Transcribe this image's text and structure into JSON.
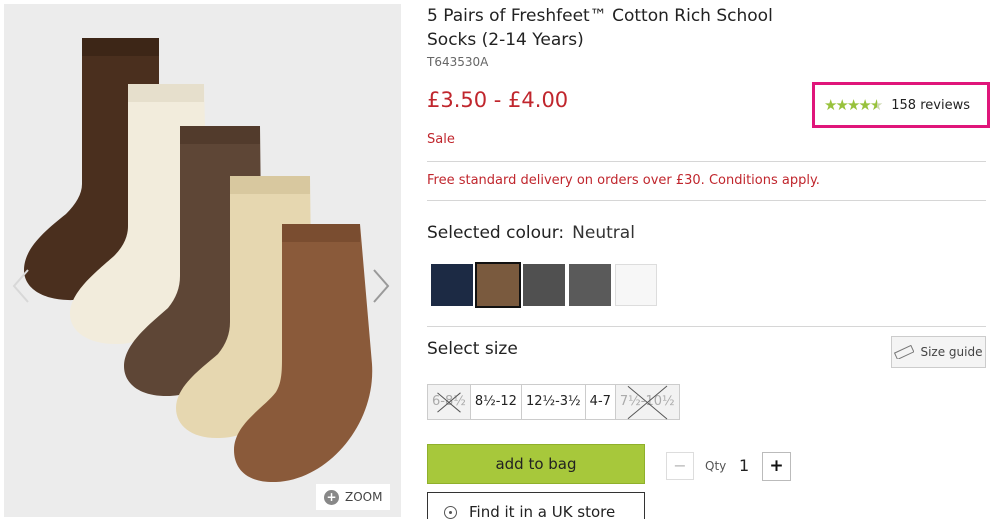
{
  "product": {
    "title": "5 Pairs of Freshfeet™ Cotton Rich School Socks (2-14 Years)",
    "code": "T643530A",
    "price": "£3.50 - £4.00",
    "sale_label": "Sale",
    "delivery_note": "Free standard delivery on orders over £30. Conditions apply."
  },
  "reviews": {
    "rating": 4.5,
    "max_rating": 5,
    "count_label": "158 reviews",
    "star_color": "#98c23c",
    "highlight_color": "#e0157a"
  },
  "gallery": {
    "zoom_label": "ZOOM",
    "zoom_icon": "plus-circle-icon",
    "prev_icon": "chevron-left-icon",
    "next_icon": "chevron-right-icon",
    "sock_colors": [
      "#4a2f1e",
      "#f2ecdc",
      "#5e4636",
      "#e6d7b0",
      "#8a5a3a"
    ]
  },
  "colour": {
    "label": "Selected colour:",
    "selected": "Neutral",
    "swatches": [
      {
        "color": "#1c2a44",
        "selected": false
      },
      {
        "color": "#7a5a3e",
        "selected": true
      },
      {
        "color": "#505050",
        "selected": false
      },
      {
        "color": "#5a5a5a",
        "selected": false
      },
      {
        "color": "#f7f7f7",
        "selected": false
      }
    ]
  },
  "size": {
    "label": "Select size",
    "guide_label": "Size guide",
    "guide_icon": "ruler-icon",
    "options": [
      {
        "label": "6-8½",
        "available": false
      },
      {
        "label": "8½-12",
        "available": true
      },
      {
        "label": "12½-3½",
        "available": true
      },
      {
        "label": "4-7",
        "available": true
      },
      {
        "label": "7½-10½",
        "available": false
      }
    ]
  },
  "purchase": {
    "add_to_bag": "add to bag",
    "qty_label": "Qty",
    "qty_value": "1",
    "minus": "−",
    "plus": "+",
    "find_store": "Find it in a UK store",
    "accent_color": "#a7c83b",
    "price_color": "#c0262d"
  }
}
